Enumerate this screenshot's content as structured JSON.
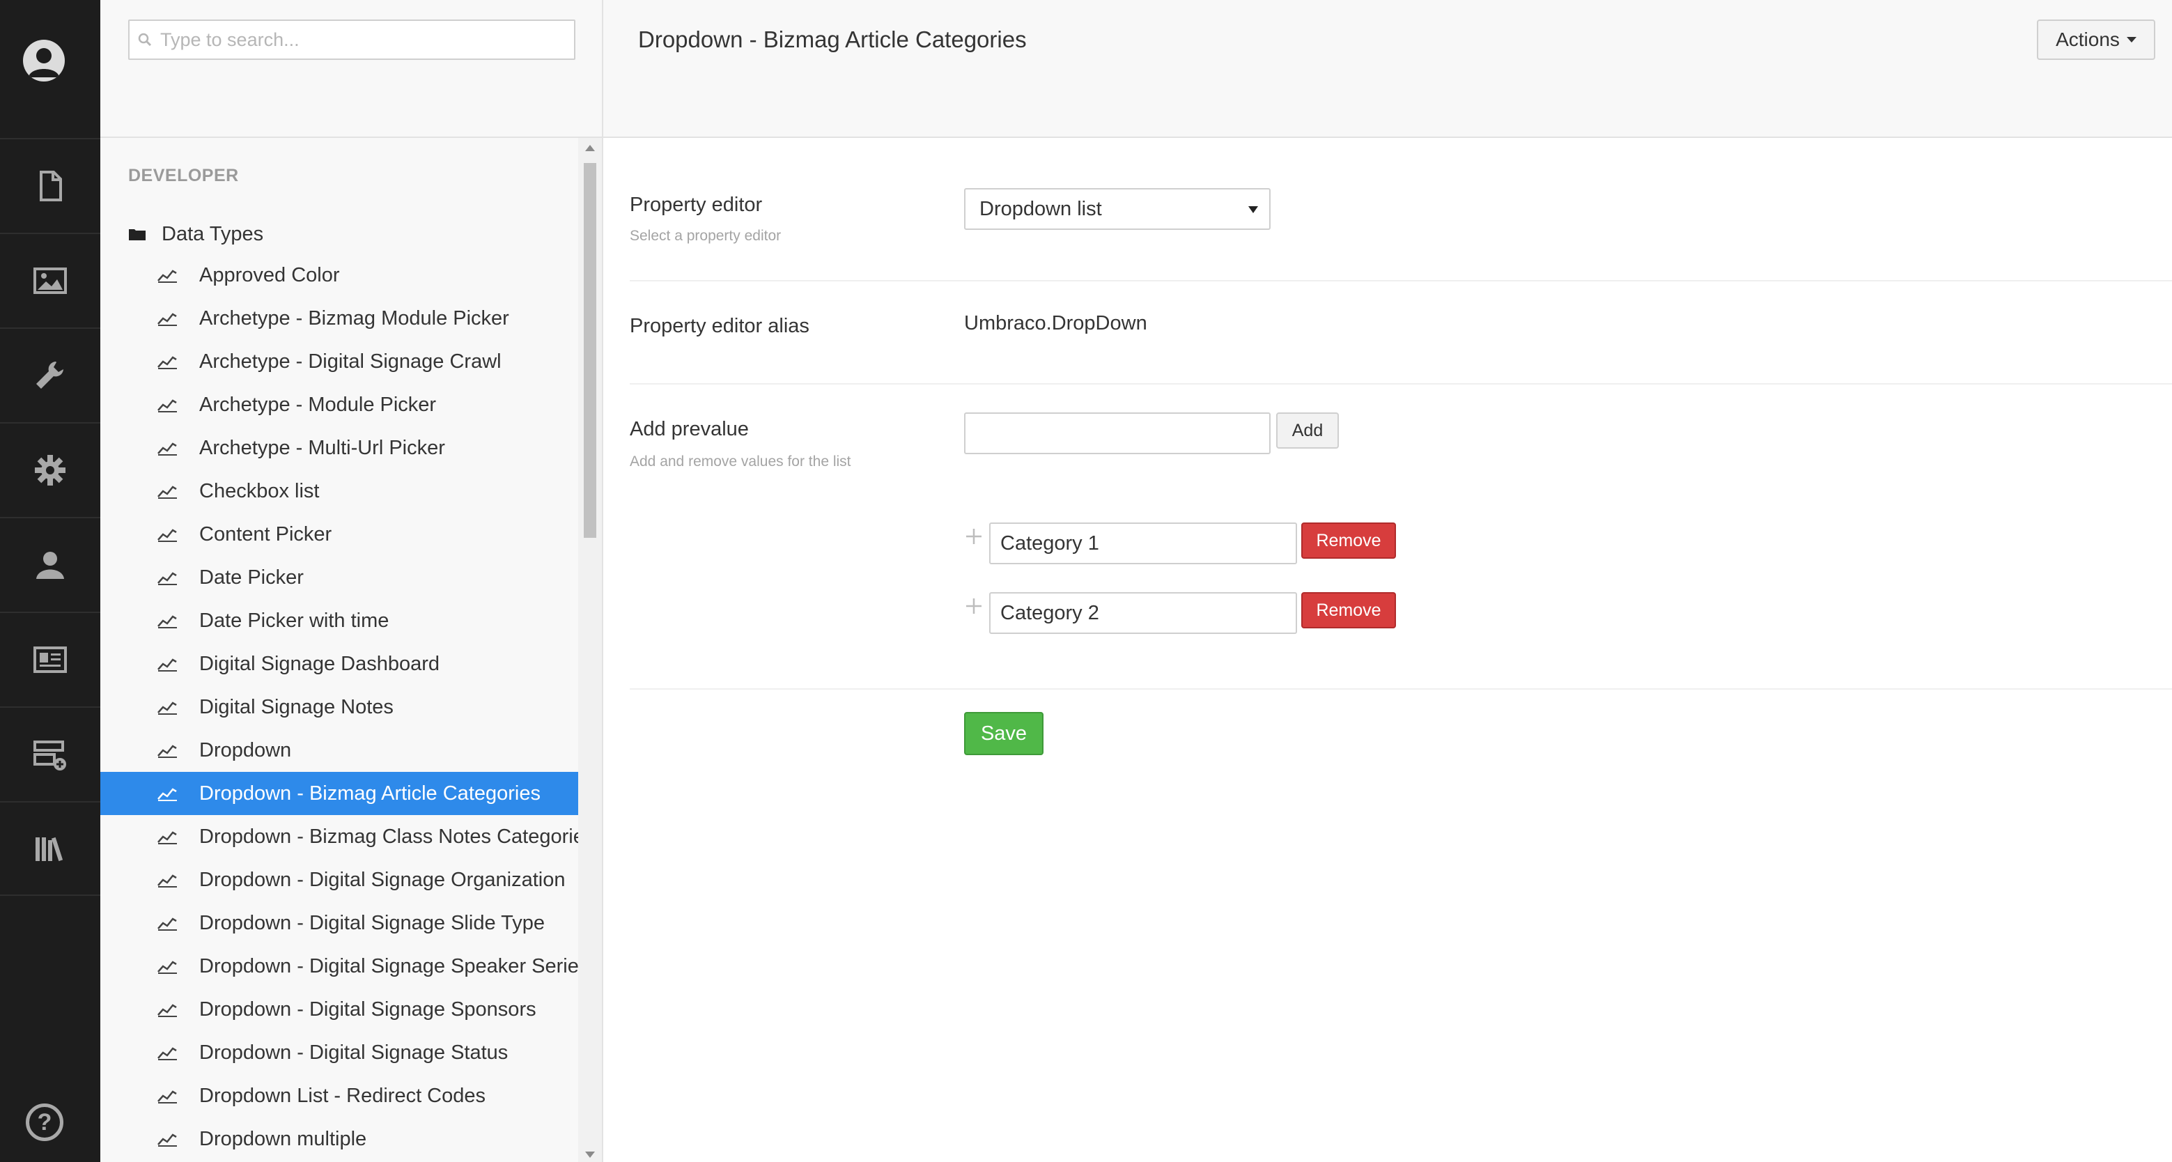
{
  "appbar": {
    "sections": [
      {
        "name": "content",
        "icon": "document-icon"
      },
      {
        "name": "media",
        "icon": "image-icon"
      },
      {
        "name": "settings",
        "icon": "wrench-icon"
      },
      {
        "name": "developer",
        "icon": "gear-icon"
      },
      {
        "name": "users",
        "icon": "user-icon"
      },
      {
        "name": "members",
        "icon": "id-card-icon"
      },
      {
        "name": "forms",
        "icon": "form-add-icon"
      },
      {
        "name": "translation",
        "icon": "books-icon"
      }
    ],
    "help_label": "?"
  },
  "tree": {
    "search_placeholder": "Type to search...",
    "section_title": "DEVELOPER",
    "root_label": "Data Types",
    "items": [
      {
        "label": "Approved Color"
      },
      {
        "label": "Archetype - Bizmag Module Picker"
      },
      {
        "label": "Archetype - Digital Signage Crawl"
      },
      {
        "label": "Archetype - Module Picker"
      },
      {
        "label": "Archetype - Multi-Url Picker"
      },
      {
        "label": "Checkbox list"
      },
      {
        "label": "Content Picker"
      },
      {
        "label": "Date Picker"
      },
      {
        "label": "Date Picker with time"
      },
      {
        "label": "Digital Signage Dashboard"
      },
      {
        "label": "Digital Signage Notes"
      },
      {
        "label": "Dropdown"
      },
      {
        "label": "Dropdown - Bizmag Article Categories",
        "active": true
      },
      {
        "label": "Dropdown - Bizmag Class Notes Categories"
      },
      {
        "label": "Dropdown - Digital Signage Organization"
      },
      {
        "label": "Dropdown - Digital Signage Slide Type"
      },
      {
        "label": "Dropdown - Digital Signage Speaker Series"
      },
      {
        "label": "Dropdown - Digital Signage Sponsors"
      },
      {
        "label": "Dropdown - Digital Signage Status"
      },
      {
        "label": "Dropdown List - Redirect Codes"
      },
      {
        "label": "Dropdown multiple"
      }
    ]
  },
  "main": {
    "title": "Dropdown - Bizmag Article Categories",
    "actions_label": "Actions",
    "property_editor": {
      "label": "Property editor",
      "description": "Select a property editor",
      "selected": "Dropdown list"
    },
    "alias": {
      "label": "Property editor alias",
      "value": "Umbraco.DropDown"
    },
    "prevalue": {
      "label": "Add prevalue",
      "description": "Add and remove values for the list",
      "add_label": "Add",
      "input_value": "",
      "values": [
        {
          "value": "Category 1",
          "remove_label": "Remove"
        },
        {
          "value": "Category 2",
          "remove_label": "Remove"
        }
      ]
    },
    "save_label": "Save"
  },
  "colors": {
    "appbar": "#1d1d1d",
    "active_item": "#2e8aea",
    "remove": "#d73d3d",
    "save": "#50b848"
  }
}
